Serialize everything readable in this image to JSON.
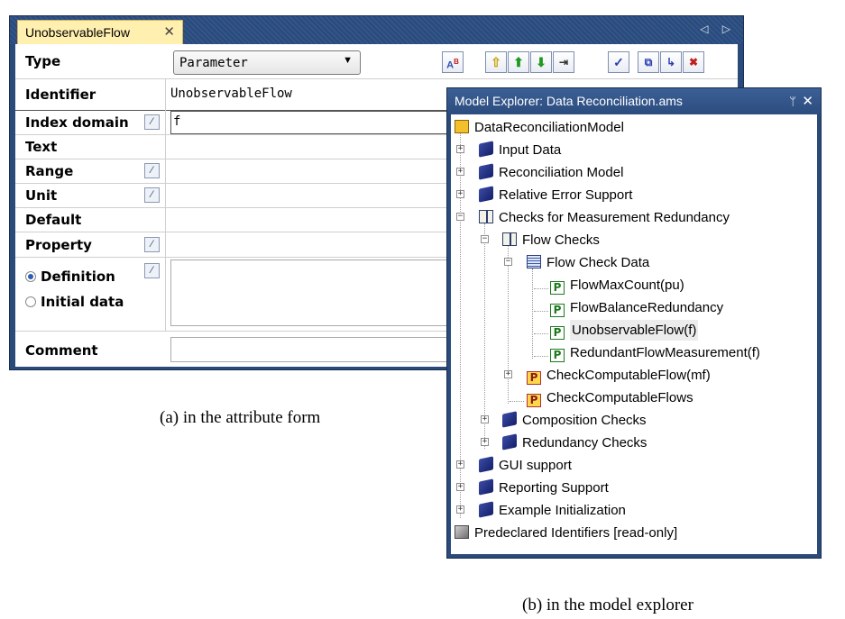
{
  "attribute_form": {
    "tab_label": "UnobservableFlow",
    "tab_close": "✕",
    "tab_arrows": "◁ ▷",
    "type_label": "Type",
    "type_value": "Parameter",
    "type_toolbar_icons": [
      "format-text-icon",
      "move-up-icon",
      "move-up-green-icon",
      "move-down-icon",
      "indent-icon",
      "check-icon",
      "open-in-icon",
      "export-icon",
      "delete-icon"
    ],
    "rows": {
      "identifier": {
        "label": "Identifier",
        "value": "UnobservableFlow"
      },
      "index_domain": {
        "label": "Index domain",
        "value": "f"
      },
      "text": {
        "label": "Text",
        "value": ""
      },
      "range": {
        "label": "Range",
        "value": ""
      },
      "unit": {
        "label": "Unit",
        "value": ""
      },
      "default": {
        "label": "Default",
        "value": ""
      },
      "property": {
        "label": "Property",
        "value": ""
      },
      "definition": {
        "label": "Definition",
        "selected": true
      },
      "initial_data": {
        "label": "Initial data",
        "selected": false
      },
      "comment": {
        "label": "Comment",
        "value": ""
      }
    }
  },
  "model_explorer": {
    "title": "Model Explorer: Data Reconciliation.ams",
    "pin": "ᛘ",
    "close": "✕",
    "tree": [
      {
        "label": "DataReconciliationModel",
        "icon": "model-icon"
      },
      {
        "label": "Input Data",
        "icon": "book-icon"
      },
      {
        "label": "Reconciliation Model",
        "icon": "book-icon"
      },
      {
        "label": "Relative Error Support",
        "icon": "book-icon"
      },
      {
        "label": "Checks for Measurement Redundancy",
        "icon": "open-book-icon"
      },
      {
        "label": "Flow Checks",
        "icon": "open-book-icon"
      },
      {
        "label": "Flow Check Data",
        "icon": "declaration-icon"
      },
      {
        "label": "FlowMaxCount(pu)",
        "icon": "parameter-icon"
      },
      {
        "label": "FlowBalanceRedundancy",
        "icon": "parameter-icon"
      },
      {
        "label": "UnobservableFlow(f)",
        "icon": "parameter-icon"
      },
      {
        "label": "RedundantFlowMeasurement(f)",
        "icon": "parameter-icon"
      },
      {
        "label": "CheckComputableFlow(mf)",
        "icon": "procedure-icon"
      },
      {
        "label": "CheckComputableFlows",
        "icon": "procedure-icon"
      },
      {
        "label": "Composition Checks",
        "icon": "book-icon"
      },
      {
        "label": "Redundancy Checks",
        "icon": "book-icon"
      },
      {
        "label": "GUI support",
        "icon": "book-icon"
      },
      {
        "label": "Reporting Support",
        "icon": "book-icon"
      },
      {
        "label": "Example Initialization",
        "icon": "book-icon"
      },
      {
        "label": "Predeclared Identifiers [read-only]",
        "icon": "predeclared-icon"
      }
    ],
    "expander_minus": "−",
    "expander_plus": "+",
    "p_glyph": "P"
  },
  "captions": {
    "a": "(a) in the attribute form",
    "b": "(b) in the model explorer"
  }
}
